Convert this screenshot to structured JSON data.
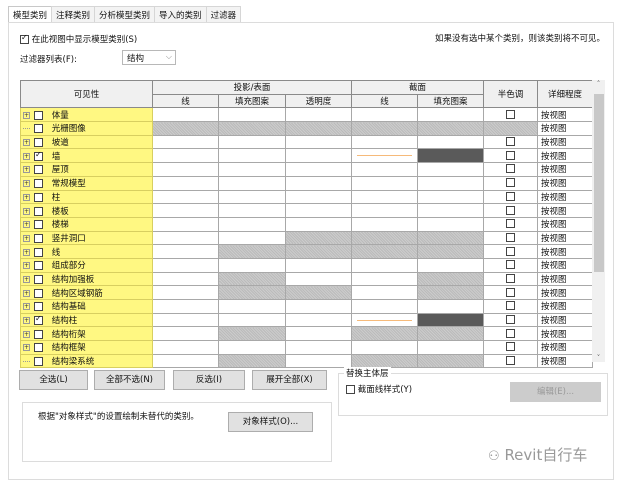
{
  "tabs": [
    "模型类别",
    "注释类别",
    "分析模型类别",
    "导入的类别",
    "过滤器"
  ],
  "show_model_categories": {
    "label": "在此视图中显示模型类别(S)",
    "checked": true
  },
  "hint": "如果没有选中某个类别，则该类别将不可见。",
  "filter_list": {
    "label": "过滤器列表(F):",
    "value": "结构"
  },
  "table": {
    "headers": {
      "visibility": "可见性",
      "projection": "投影/表面",
      "cut": "截面",
      "halftone": "半色调",
      "detail": "详细程度",
      "line": "线",
      "fill": "填充图案",
      "transparency": "透明度"
    },
    "rows": [
      {
        "name": "体量",
        "checked": false,
        "expandable": true,
        "hatch": [],
        "detail": "按视图"
      },
      {
        "name": "光栅图像",
        "checked": false,
        "expandable": false,
        "hatch": [
          0,
          1,
          2,
          3,
          4,
          5
        ],
        "detail": "按视图"
      },
      {
        "name": "坡道",
        "checked": false,
        "expandable": true,
        "hatch": [],
        "detail": "按视图"
      },
      {
        "name": "墙",
        "checked": true,
        "expandable": true,
        "hatch": [],
        "override": true,
        "detail": "按视图"
      },
      {
        "name": "屋顶",
        "checked": false,
        "expandable": true,
        "hatch": [],
        "detail": "按视图"
      },
      {
        "name": "常规模型",
        "checked": false,
        "expandable": true,
        "hatch": [],
        "detail": "按视图"
      },
      {
        "name": "柱",
        "checked": false,
        "expandable": true,
        "hatch": [],
        "detail": "按视图"
      },
      {
        "name": "楼板",
        "checked": false,
        "expandable": true,
        "hatch": [],
        "detail": "按视图"
      },
      {
        "name": "楼梯",
        "checked": false,
        "expandable": true,
        "hatch": [],
        "detail": "按视图"
      },
      {
        "name": "竖井洞口",
        "checked": false,
        "expandable": true,
        "hatch": [
          2,
          3,
          4
        ],
        "detail": "按视图"
      },
      {
        "name": "线",
        "checked": false,
        "expandable": true,
        "hatch": [
          1,
          2,
          3,
          4
        ],
        "detail": "按视图"
      },
      {
        "name": "组成部分",
        "checked": false,
        "expandable": true,
        "hatch": [],
        "detail": "按视图"
      },
      {
        "name": "结构加强板",
        "checked": false,
        "expandable": true,
        "hatch": [
          1,
          4
        ],
        "detail": "按视图"
      },
      {
        "name": "结构区域钢筋",
        "checked": false,
        "expandable": true,
        "hatch": [
          1,
          2,
          4
        ],
        "detail": "按视图"
      },
      {
        "name": "结构基础",
        "checked": false,
        "expandable": true,
        "hatch": [],
        "detail": "按视图"
      },
      {
        "name": "结构柱",
        "checked": true,
        "expandable": true,
        "hatch": [],
        "override": true,
        "detail": "按视图"
      },
      {
        "name": "结构桁架",
        "checked": false,
        "expandable": true,
        "hatch": [
          1,
          3,
          4
        ],
        "detail": "按视图"
      },
      {
        "name": "结构框架",
        "checked": false,
        "expandable": true,
        "hatch": [],
        "detail": "按视图"
      },
      {
        "name": "结构梁系统",
        "checked": false,
        "expandable": false,
        "hatch": [
          1,
          3,
          4
        ],
        "detail": "按视图"
      }
    ]
  },
  "buttons": {
    "select_all": "全选(L)",
    "select_none": "全部不选(N)",
    "invert": "反选(I)",
    "expand_all": "展开全部(X)",
    "object_styles": "对象样式(O)...",
    "edit": "编辑(E)..."
  },
  "info": "根据\"对象样式\"的设置绘制未替代的类别。",
  "host_layers": {
    "title": "替换主体层",
    "cut_line_styles": "截面线样式(Y)"
  },
  "watermark": "Revit自行车",
  "colors": {
    "visibility_bg": "#fff882",
    "cut_line": "#f6ba7a",
    "cut_fill": "#5a5a5a"
  }
}
